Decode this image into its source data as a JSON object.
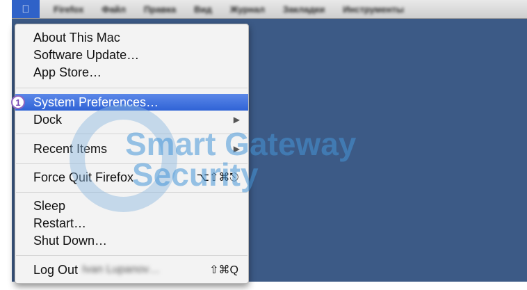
{
  "menubar": {
    "apple_icon": "apple-icon",
    "items": [
      "Firefox",
      "Файл",
      "Правка",
      "Вид",
      "Журнал",
      "Закладки",
      "Инструменты"
    ]
  },
  "apple_menu": {
    "about": "About This Mac",
    "software_update": "Software Update…",
    "app_store": "App Store…",
    "system_preferences": "System Preferences…",
    "dock": "Dock",
    "recent_items": "Recent Items",
    "force_quit": "Force Quit Firefox",
    "force_quit_shortcut": "⌥⇧⌘⎋",
    "sleep": "Sleep",
    "restart": "Restart…",
    "shut_down": "Shut Down…",
    "log_out": "Log Out",
    "log_out_user": "Ivan Lupanov…",
    "log_out_shortcut": "⇧⌘Q"
  },
  "step_badge": "1",
  "watermark": {
    "line1": "Smart Gateway",
    "line2": "Security"
  },
  "colors": {
    "desktop": "#3c5a86",
    "highlight": "#2f63d6",
    "badge_border": "#8e66c4"
  }
}
